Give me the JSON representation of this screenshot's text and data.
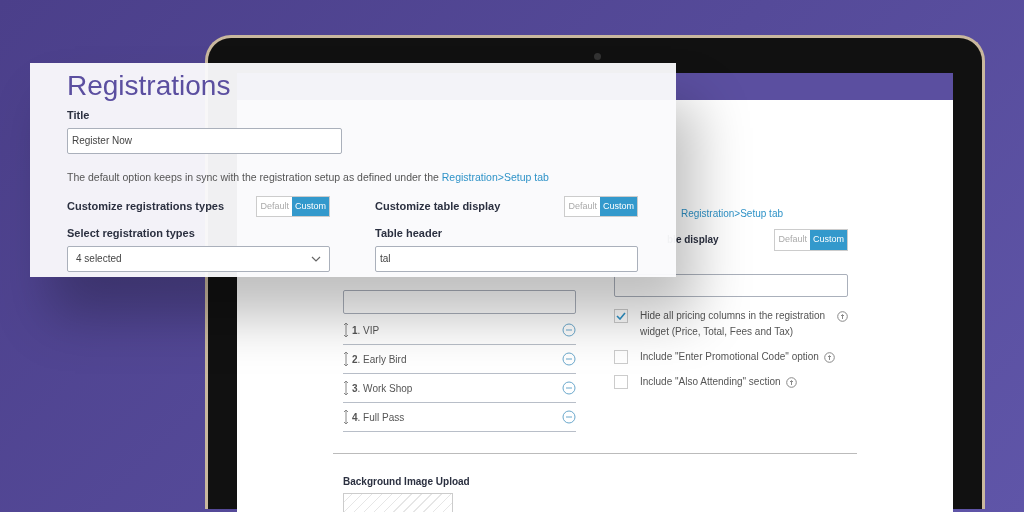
{
  "overlay": {
    "heading": "Registrations",
    "title_label": "Title",
    "title_value": "Register Now",
    "note": "The default option keeps in sync with the registration setup as defined under the",
    "note_link": "Registration>Setup tab",
    "toggles": [
      {
        "label": "Customize registrations types",
        "options": [
          {
            "label": "Default",
            "selected": false
          },
          {
            "label": "Custom",
            "selected": true
          }
        ]
      },
      {
        "label": "Customize table display",
        "options": [
          {
            "label": "Default",
            "selected": false
          },
          {
            "label": "Custom",
            "selected": true
          }
        ]
      }
    ],
    "select": {
      "label": "Select registration types",
      "value": "4 selected"
    },
    "table_header": {
      "label": "Table header",
      "value": "tal"
    }
  },
  "screen": {
    "link": "Registration>Setup tab",
    "toggle": {
      "label": "ble display",
      "options": [
        {
          "label": "Default",
          "selected": false
        },
        {
          "label": "Custom",
          "selected": true
        }
      ]
    },
    "registration_types": [
      {
        "name": "**1**. VIP"
      },
      {
        "name": "**2**. Early Bird"
      },
      {
        "name": "**3**. Work Shop"
      },
      {
        "name": "**4**. Full Pass"
      }
    ],
    "options": [
      {
        "label": "Hide all pricing columns in the registration widget (Price, Total, Fees and Tax)",
        "checked": true
      },
      {
        "label": "Include \"Enter Promotional Code\" option",
        "checked": false
      },
      {
        "label": "Include \"Also Attending\" section",
        "checked": false
      }
    ],
    "upload_label": "Background Image Upload"
  }
}
